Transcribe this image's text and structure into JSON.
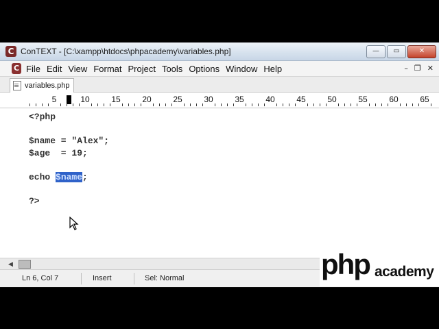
{
  "window": {
    "title": "ConTEXT - [C:\\xampp\\htdocs\\phpacademy\\variables.php]",
    "app_icon": "context-app-icon",
    "buttons": {
      "minimize": "—",
      "maximize": "▭",
      "close": "✕"
    }
  },
  "menubar": {
    "items": [
      "File",
      "Edit",
      "View",
      "Format",
      "Project",
      "Tools",
      "Options",
      "Window",
      "Help"
    ],
    "mdi": {
      "minimize": "–",
      "restore": "❐",
      "close": "✕"
    }
  },
  "tabs": [
    {
      "label": "variables.php",
      "active": true
    }
  ],
  "ruler": {
    "labels": [
      "5",
      "10",
      "15",
      "20",
      "25",
      "30",
      "35",
      "40",
      "45",
      "50",
      "55",
      "60",
      "65"
    ]
  },
  "editor": {
    "lines": [
      "<?php",
      "",
      "$name = \"Alex\";",
      "$age  = 19;",
      "",
      "echo ",
      "",
      "?>"
    ],
    "line6_selected": "$name",
    "line6_after": ";"
  },
  "statusbar": {
    "position": "Ln 6, Col 7",
    "mode": "Insert",
    "syntax": "Sel: Normal"
  },
  "logo": {
    "part1": "php",
    "part2": "academy"
  },
  "colors": {
    "selection": "#2f62c9",
    "titlebar": "#d7e2ee",
    "code": "#333333"
  }
}
